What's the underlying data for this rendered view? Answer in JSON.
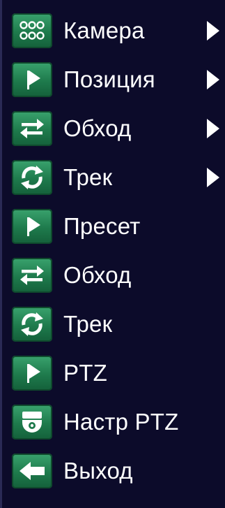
{
  "menu": {
    "items": [
      {
        "label": "Камера",
        "icon": "camera-grid-icon",
        "submenu": true
      },
      {
        "label": "Позиция",
        "icon": "flag-icon",
        "submenu": true
      },
      {
        "label": "Обход",
        "icon": "swap-arrows-icon",
        "submenu": true
      },
      {
        "label": "Трек",
        "icon": "cycle-arrows-icon",
        "submenu": true
      },
      {
        "label": "Пресет",
        "icon": "flag-icon",
        "submenu": false
      },
      {
        "label": "Обход",
        "icon": "swap-arrows-icon",
        "submenu": false
      },
      {
        "label": "Трек",
        "icon": "cycle-arrows-icon",
        "submenu": false
      },
      {
        "label": "PTZ",
        "icon": "flag-icon",
        "submenu": false
      },
      {
        "label": "Настр PTZ",
        "icon": "dome-camera-icon",
        "submenu": false
      },
      {
        "label": "Выход",
        "icon": "left-arrow-icon",
        "submenu": false
      }
    ]
  }
}
